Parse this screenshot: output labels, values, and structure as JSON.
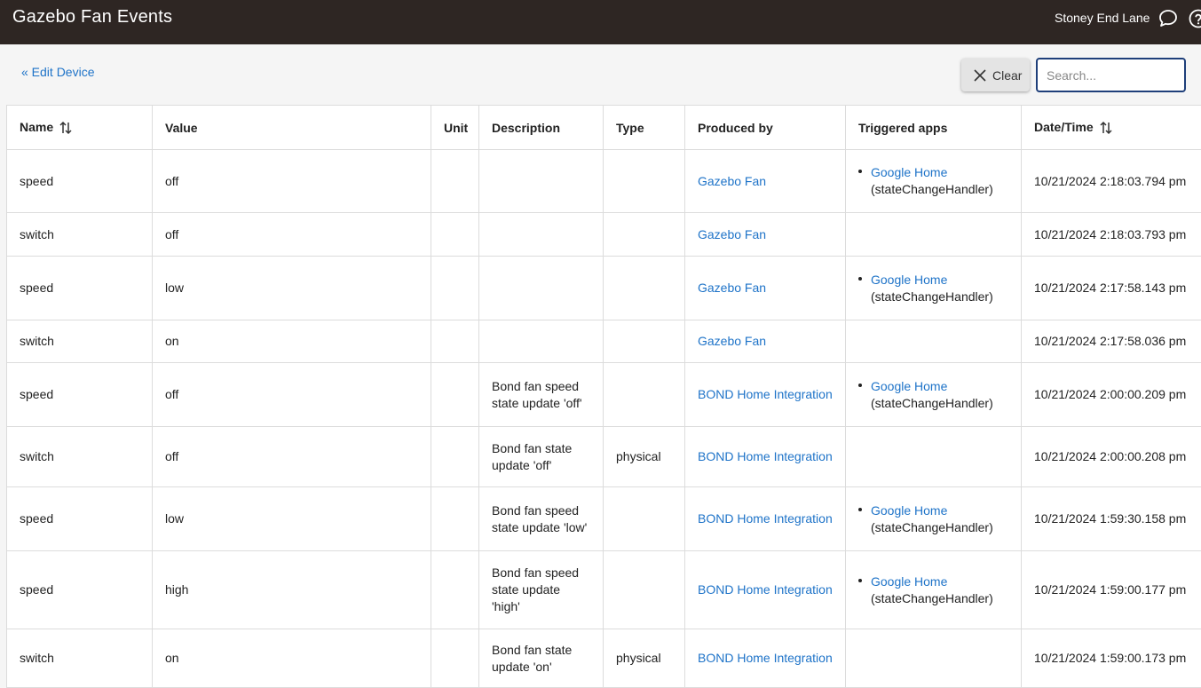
{
  "header": {
    "title": "Gazebo Fan Events",
    "hub_name": "Stoney End Lane",
    "chat_icon": "chat-bubble-icon",
    "help_icon": "help-circle-icon"
  },
  "toolbar": {
    "edit_device_label": "« Edit Device",
    "clear_label": "Clear",
    "search_placeholder": "Search..."
  },
  "table": {
    "columns": [
      "Name",
      "Value",
      "Unit",
      "Description",
      "Type",
      "Produced by",
      "Triggered apps",
      "Date/Time"
    ],
    "rows": [
      {
        "name": "speed",
        "value": "off",
        "unit": "",
        "description": "",
        "type": "",
        "produced_by": "Gazebo Fan",
        "app": "Google Home",
        "handler": "(stateChangeHandler)",
        "datetime": "10/21/2024 2:18:03.794 pm"
      },
      {
        "name": "switch",
        "value": "off",
        "unit": "",
        "description": "",
        "type": "",
        "produced_by": "Gazebo Fan",
        "app": "",
        "handler": "",
        "datetime": "10/21/2024 2:18:03.793 pm"
      },
      {
        "name": "speed",
        "value": "low",
        "unit": "",
        "description": "",
        "type": "",
        "produced_by": "Gazebo Fan",
        "app": "Google Home",
        "handler": "(stateChangeHandler)",
        "datetime": "10/21/2024 2:17:58.143 pm"
      },
      {
        "name": "switch",
        "value": "on",
        "unit": "",
        "description": "",
        "type": "",
        "produced_by": "Gazebo Fan",
        "app": "",
        "handler": "",
        "datetime": "10/21/2024 2:17:58.036 pm"
      },
      {
        "name": "speed",
        "value": "off",
        "unit": "",
        "description": "Bond fan speed state update 'off'",
        "type": "",
        "produced_by": "BOND Home Integration",
        "app": "Google Home",
        "handler": "(stateChangeHandler)",
        "datetime": "10/21/2024 2:00:00.209 pm"
      },
      {
        "name": "switch",
        "value": "off",
        "unit": "",
        "description": "Bond fan state update 'off'",
        "type": "physical",
        "produced_by": "BOND Home Integration",
        "app": "",
        "handler": "",
        "datetime": "10/21/2024 2:00:00.208 pm"
      },
      {
        "name": "speed",
        "value": "low",
        "unit": "",
        "description": "Bond fan speed state update 'low'",
        "type": "",
        "produced_by": "BOND Home Integration",
        "app": "Google Home",
        "handler": "(stateChangeHandler)",
        "datetime": "10/21/2024 1:59:30.158 pm"
      },
      {
        "name": "speed",
        "value": "high",
        "unit": "",
        "description": "Bond fan speed state update 'high'",
        "type": "",
        "produced_by": "BOND Home Integration",
        "app": "Google Home",
        "handler": "(stateChangeHandler)",
        "datetime": "10/21/2024 1:59:00.177 pm"
      },
      {
        "name": "switch",
        "value": "on",
        "unit": "",
        "description": "Bond fan state update 'on'",
        "type": "physical",
        "produced_by": "BOND Home Integration",
        "app": "",
        "handler": "",
        "datetime": "10/21/2024 1:59:00.173 pm"
      }
    ]
  }
}
